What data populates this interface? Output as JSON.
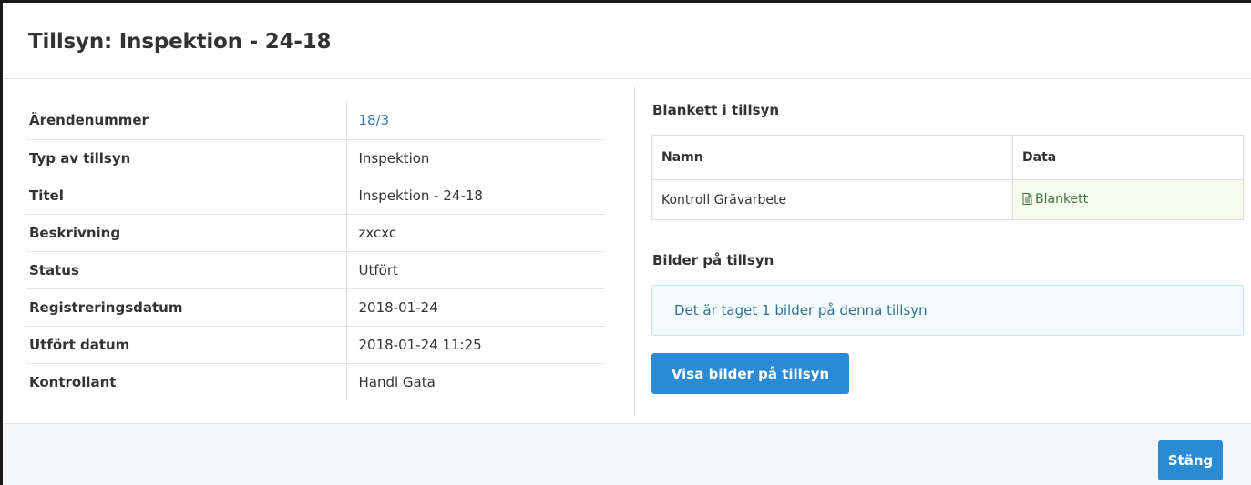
{
  "modal": {
    "title": "Tillsyn: Inspektion - 24-18"
  },
  "details": [
    {
      "label": "Ärendenummer",
      "value": "18/3"
    },
    {
      "label": "Typ av tillsyn",
      "value": "Inspektion"
    },
    {
      "label": "Titel",
      "value": "Inspektion - 24-18"
    },
    {
      "label": "Beskrivning",
      "value": "zxcxc"
    },
    {
      "label": "Status",
      "value": "Utfört"
    },
    {
      "label": "Registreringsdatum",
      "value": "2018-01-24"
    },
    {
      "label": "Utfört datum",
      "value": "2018-01-24 11:25"
    },
    {
      "label": "Kontrollant",
      "value": "Handl Gata"
    }
  ],
  "forms": {
    "heading": "Blankett i tillsyn",
    "columns": [
      "Namn",
      "Data"
    ],
    "rows": [
      {
        "name": "Kontroll Grävarbete",
        "data": "Blankett",
        "data_icon": "document-icon"
      }
    ]
  },
  "images": {
    "heading": "Bilder på tillsyn",
    "alert_text": "Det är taget 1 bilder på denna tillsyn",
    "button_label": "Visa bilder på tillsyn"
  },
  "footer": {
    "close_label": "Stäng"
  },
  "colors": {
    "link": "#337ab7",
    "primary_button": "#2a8ad4",
    "success_text": "#3c763d",
    "info_text": "#31708f"
  }
}
